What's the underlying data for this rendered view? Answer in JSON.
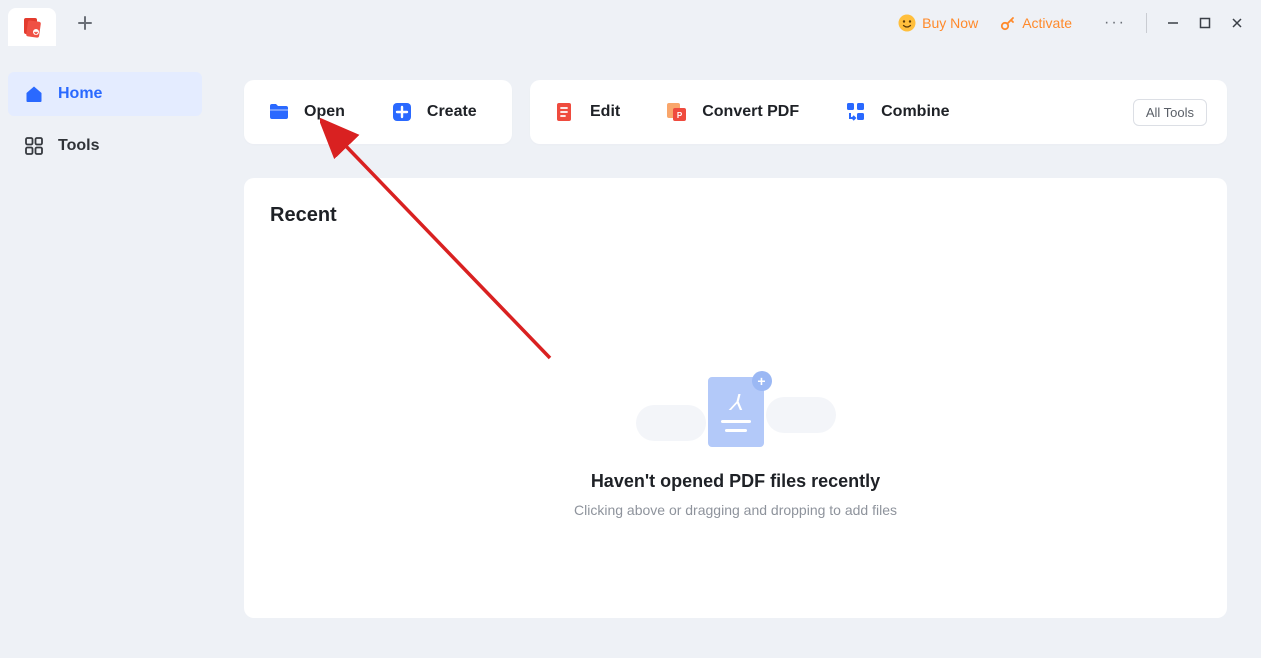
{
  "titlebar": {
    "buy_now_label": "Buy Now",
    "activate_label": "Activate"
  },
  "sidebar": {
    "home_label": "Home",
    "tools_label": "Tools"
  },
  "actions": {
    "open_label": "Open",
    "create_label": "Create",
    "edit_label": "Edit",
    "convert_label": "Convert PDF",
    "combine_label": "Combine",
    "all_tools_label": "All Tools"
  },
  "recent": {
    "heading": "Recent",
    "empty_title": "Haven't opened PDF files recently",
    "empty_sub": "Clicking above or dragging and dropping to add files"
  }
}
